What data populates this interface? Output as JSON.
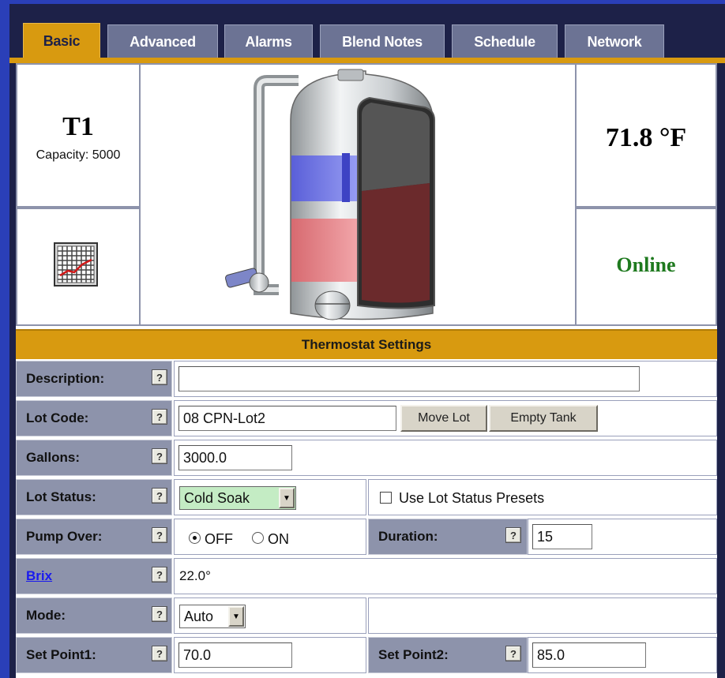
{
  "tabs": [
    {
      "label": "Basic",
      "active": true
    },
    {
      "label": "Advanced",
      "active": false
    },
    {
      "label": "Alarms",
      "active": false
    },
    {
      "label": "Blend Notes",
      "active": false
    },
    {
      "label": "Schedule",
      "active": false
    },
    {
      "label": "Network",
      "active": false
    }
  ],
  "tank": {
    "name": "T1",
    "capacity": "Capacity: 5000",
    "temperature": "71.8 °F",
    "status": "Online",
    "status_color": "#1f7a1f",
    "chart_icon": "trend-chart-icon",
    "illustration": "tank-illustration"
  },
  "settings": {
    "header": "Thermostat Settings",
    "help_glyph": "?",
    "description": {
      "label": "Description:",
      "value": ""
    },
    "lot_code": {
      "label": "Lot Code:",
      "value": "08 CPN-Lot2",
      "move_button": "Move Lot",
      "empty_button": "Empty Tank"
    },
    "gallons": {
      "label": "Gallons:",
      "value": "3000.0"
    },
    "lot_status": {
      "label": "Lot Status:",
      "value": "Cold Soak",
      "value_bg": "#c4ecc4",
      "presets_label": "Use Lot Status Presets",
      "presets_checked": false
    },
    "pump_over": {
      "label": "Pump Over:",
      "off_label": "OFF",
      "on_label": "ON",
      "selected": "OFF",
      "duration_label": "Duration:",
      "duration_value": "15"
    },
    "brix": {
      "label": "Brix",
      "value": "22.0°"
    },
    "mode": {
      "label": "Mode:",
      "value": "Auto"
    },
    "set_point1": {
      "label": "Set Point1:",
      "value": "70.0"
    },
    "set_point2": {
      "label": "Set Point2:",
      "value": "85.0"
    }
  },
  "colors": {
    "accent": "#d89a10",
    "label_bg": "#8d93ab",
    "frame_bg": "#1d2148",
    "page_bg": "#2a3fb8"
  }
}
